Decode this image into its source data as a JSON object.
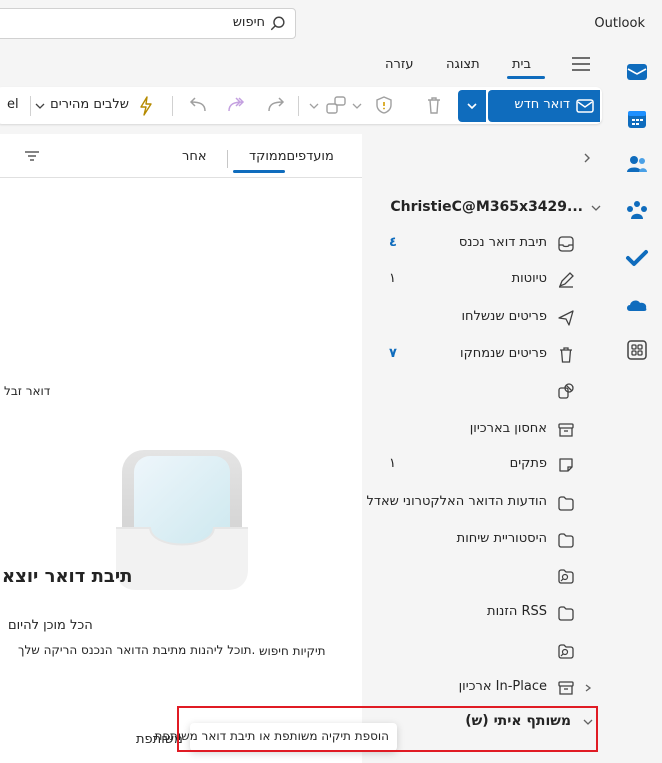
{
  "app": {
    "title": "Outlook"
  },
  "search": {
    "placeholder": "חיפוש"
  },
  "ribbon": {
    "tabs": [
      {
        "label": "בית",
        "active": true
      },
      {
        "label": "תצוגה"
      },
      {
        "label": "עזרה"
      }
    ],
    "new_mail_label": "דואר חדש",
    "quick_steps_label": "שלבים מהירים",
    "overflow_text": "el"
  },
  "folder_pane": {
    "account": "ChristieC@M365x3429...",
    "folders": [
      {
        "label": "תיבת דואר נכנס",
        "icon": "inbox-icon",
        "count": "٤",
        "count_style": "blue"
      },
      {
        "label": "טיוטות",
        "icon": "drafts-icon",
        "count": "١",
        "count_style": "gray"
      },
      {
        "label": "פריטים שנשלחו",
        "icon": "send-icon",
        "count": "",
        "count_style": ""
      },
      {
        "label": "פריטים שנמחקו",
        "icon": "trash-icon",
        "count": "٧",
        "count_style": "blue"
      },
      {
        "label": "",
        "icon": "junk-icon",
        "count": "",
        "count_style": ""
      },
      {
        "label": "אחסון בארכיון",
        "icon": "archive-icon",
        "count": "",
        "count_style": ""
      },
      {
        "label": "פתקים",
        "icon": "note-icon",
        "count": "١",
        "count_style": "gray"
      },
      {
        "label": "הודעות הדואר האלקטרוני שאדל",
        "icon": "folder-icon",
        "count": "",
        "count_style": ""
      },
      {
        "label": "היסטוריית שיחות",
        "icon": "folder-icon",
        "count": "",
        "count_style": ""
      },
      {
        "label": "",
        "icon": "search-folder-icon",
        "count": "",
        "count_style": ""
      },
      {
        "label": "הזנות RSS",
        "icon": "folder-icon",
        "count": "",
        "count_style": ""
      },
      {
        "label": "",
        "icon": "search-folder-icon",
        "count": "",
        "count_style": ""
      },
      {
        "label": "ארכיון In-Place",
        "icon": "archive-icon",
        "count": "",
        "count_style": ""
      }
    ],
    "shared_group": "(ש) משותף איתי",
    "add_shared_label": "הוספת תיקיה משותפת או תיבת דואר משותפת"
  },
  "message_list": {
    "tabs": [
      {
        "label": "מועדפיםממוקד",
        "active": true
      },
      {
        "label": "אחר"
      }
    ],
    "junk_label": "דואר זבל",
    "empty_title": "תיבת דואר יוצא",
    "empty_line1": "הכל מוכן להיום",
    "empty_line2": "תוכל ליהנות מתיבת הדואר הנכנס הריקה שלך.",
    "search_folders_label": "תיקיות חיפוש",
    "shared_label": "משותפת"
  },
  "colors": {
    "accent": "#0f6cbd",
    "highlight": "#e01b24"
  }
}
